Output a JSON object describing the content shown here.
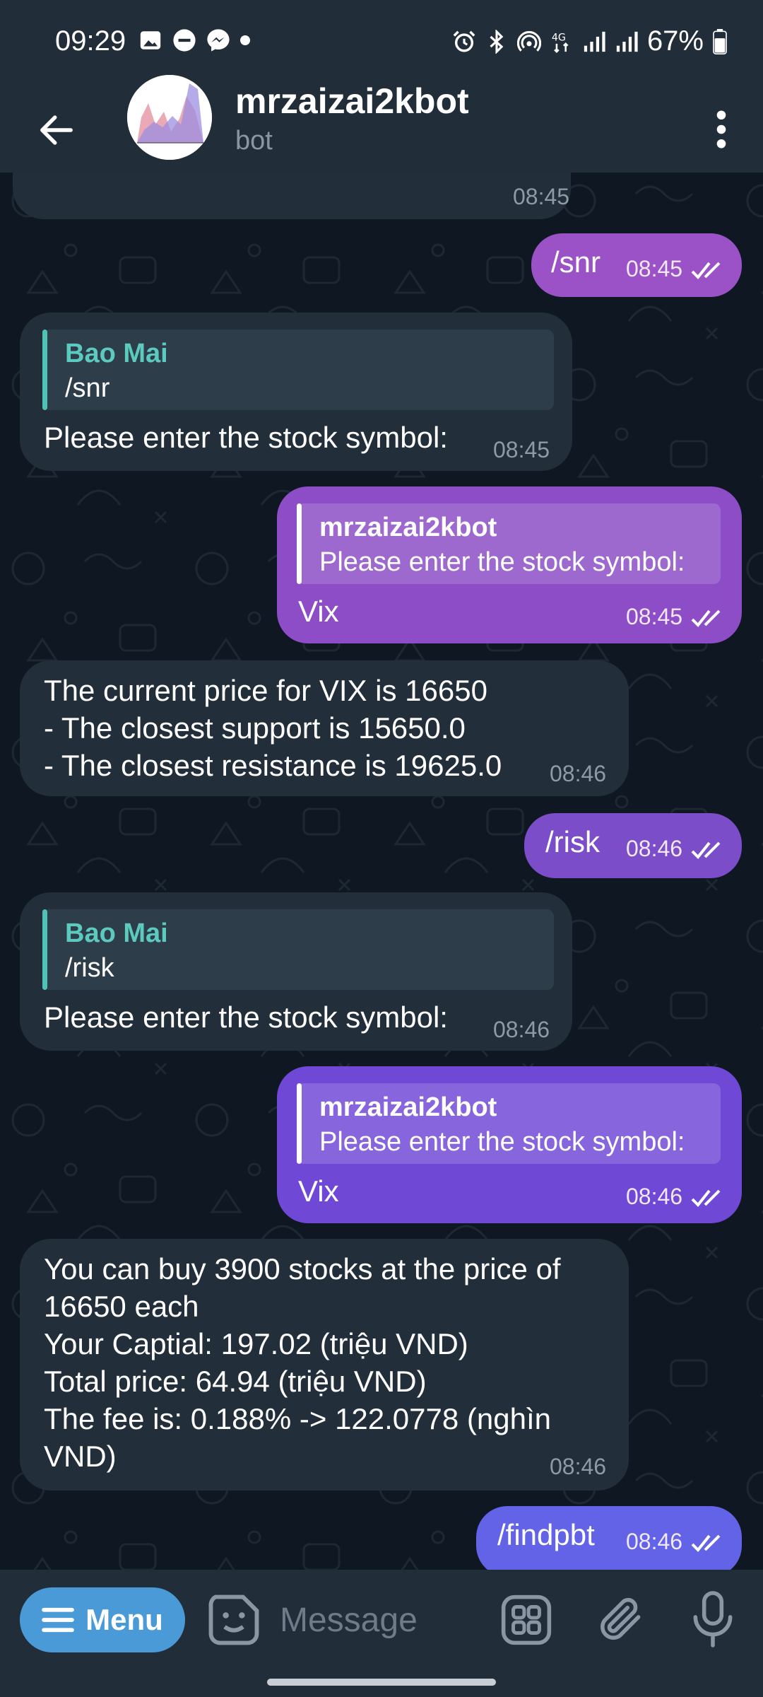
{
  "status_bar": {
    "time": "09:29",
    "battery": "67%",
    "icons": [
      "gallery-icon",
      "do-not-disturb-icon",
      "messenger-icon",
      "dot-icon",
      "alarm-icon",
      "bluetooth-icon",
      "hotspot-icon",
      "4g-icon",
      "signal-icon",
      "signal-icon",
      "battery-icon"
    ]
  },
  "header": {
    "title": "mrzaizai2kbot",
    "subtitle": "bot"
  },
  "messages": [
    {
      "id": "m0",
      "dir": "in",
      "text": "-------------------------",
      "time": "08:45"
    },
    {
      "id": "m1",
      "dir": "out",
      "text": "/snr",
      "time": "08:45"
    },
    {
      "id": "m2",
      "dir": "in",
      "reply_name": "Bao Mai",
      "reply_text": "/snr",
      "text": "Please enter the stock symbol:",
      "time": "08:45"
    },
    {
      "id": "m3",
      "dir": "out",
      "reply_name": "mrzaizai2kbot",
      "reply_text": "Please enter the stock symbol:",
      "text": "Vix",
      "time": "08:45"
    },
    {
      "id": "m4",
      "dir": "in",
      "text": "The current price for VIX is 16650\n- The closest support is 15650.0\n- The closest resistance is 19625.0",
      "time": "08:46"
    },
    {
      "id": "m5",
      "dir": "out",
      "text": "/risk",
      "time": "08:46"
    },
    {
      "id": "m6",
      "dir": "in",
      "reply_name": "Bao Mai",
      "reply_text": "/risk",
      "text": "Please enter the stock symbol:",
      "time": "08:46"
    },
    {
      "id": "m7",
      "dir": "out",
      "reply_name": "mrzaizai2kbot",
      "reply_text": "Please enter the stock symbol:",
      "text": "Vix",
      "time": "08:46"
    },
    {
      "id": "m8",
      "dir": "in",
      "text": "You can buy 3900 stocks at the price of\n16650 each\nYour Captial: 197.02 (triệu VND)\nTotal price: 64.94 (triệu VND)\nThe fee is: 0.188% -> 122.0778 (nghìn\nVND)",
      "time": "08:46"
    },
    {
      "id": "m9",
      "dir": "out",
      "text": "/findpbt",
      "time": "08:46"
    }
  ],
  "input_bar": {
    "menu_label": "Menu",
    "placeholder": "Message"
  },
  "colors": {
    "outgoing_top": "#a45dd0",
    "outgoing_bottom": "#6a62e8",
    "incoming": "#222e39",
    "menu_button": "#4a9ad8",
    "reply_accent": "#4fc1b5"
  }
}
